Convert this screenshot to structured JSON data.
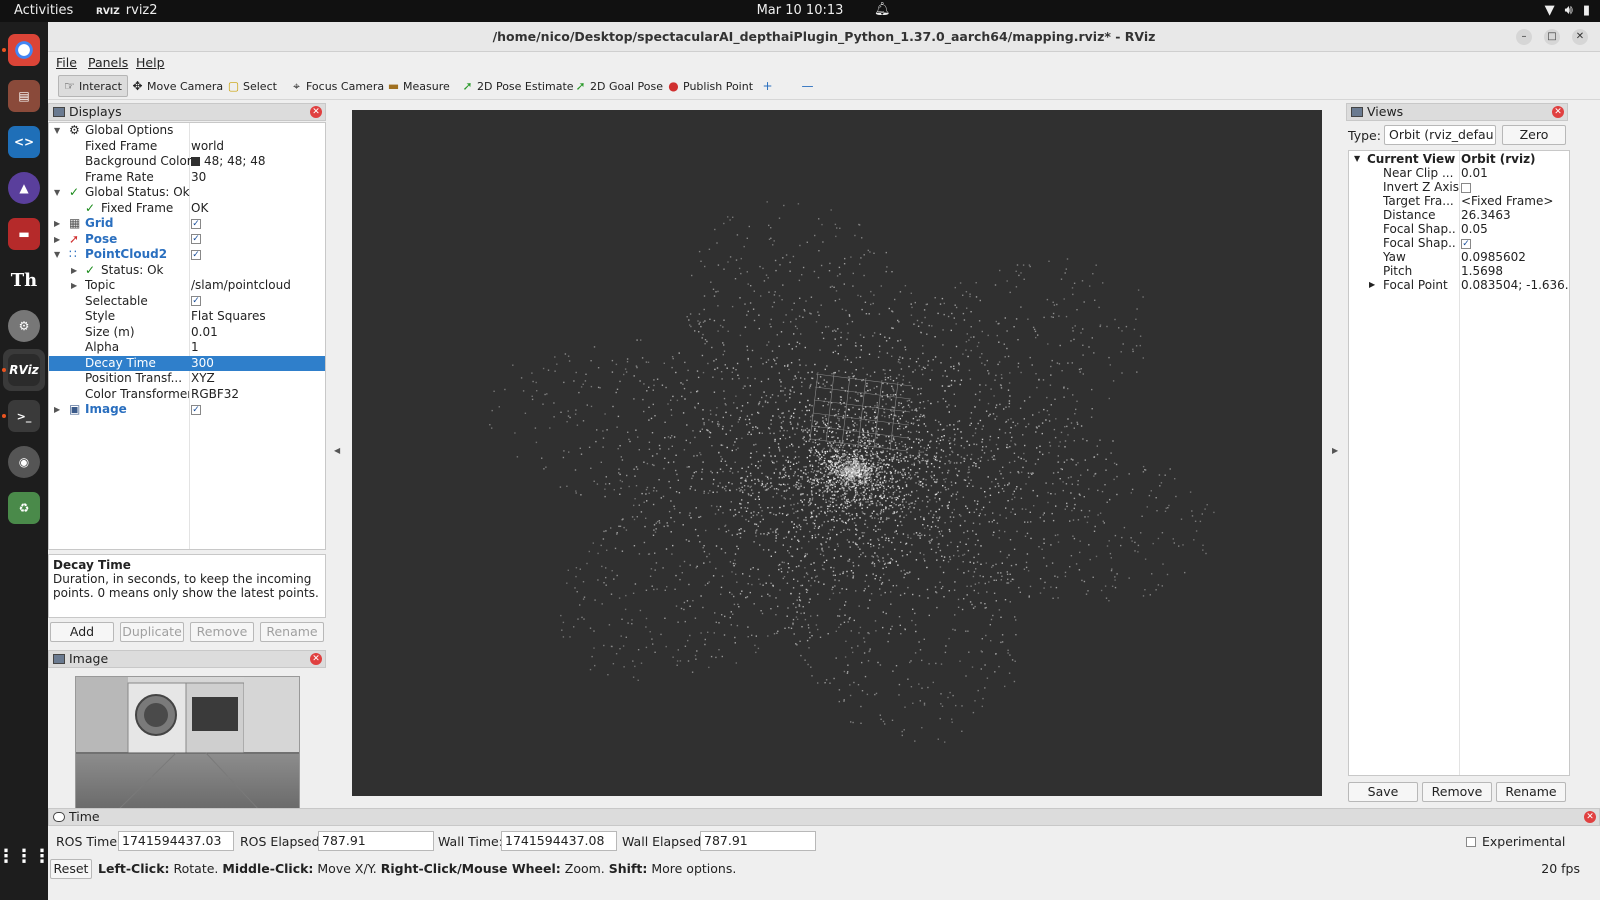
{
  "topbar": {
    "activities": "Activities",
    "app_name": "rviz2",
    "app_logo": "RVIZ",
    "clock": "Mar 10  10:13",
    "icons": [
      "notification-icon",
      "wifi-icon",
      "volume-icon",
      "battery-icon"
    ]
  },
  "dock": {
    "apps": [
      "chrome",
      "files",
      "vscode",
      "app-purple",
      "app-red",
      "typora",
      "settings",
      "rviz",
      "terminal",
      "disk",
      "trash",
      "show-apps"
    ],
    "rviz_label": "RViz"
  },
  "window": {
    "title": "/home/nico/Desktop/spectacularAI_depthaiPlugin_Python_1.37.0_aarch64/mapping.rviz* - RViz"
  },
  "menu": {
    "file": "File",
    "panels": "Panels",
    "help": "Help"
  },
  "toolbar": {
    "interact": "Interact",
    "move_camera": "Move Camera",
    "select": "Select",
    "focus_camera": "Focus Camera",
    "measure": "Measure",
    "pose_estimate": "2D Pose Estimate",
    "goal_pose": "2D Goal Pose",
    "publish_point": "Publish Point"
  },
  "displays": {
    "title": "Displays",
    "rows": {
      "global_options": "Global Options",
      "fixed_frame_k": "Fixed Frame",
      "fixed_frame_v": "world",
      "bg_color_k": "Background Color",
      "bg_color_v": "48; 48; 48",
      "frame_rate_k": "Frame Rate",
      "frame_rate_v": "30",
      "global_status": "Global Status: Ok",
      "gs_fixed_frame_k": "Fixed Frame",
      "gs_fixed_frame_v": "OK",
      "grid": "Grid",
      "pose": "Pose",
      "pointcloud": "PointCloud2",
      "status_ok": "Status: Ok",
      "topic_k": "Topic",
      "topic_v": "/slam/pointcloud",
      "selectable_k": "Selectable",
      "style_k": "Style",
      "style_v": "Flat Squares",
      "size_k": "Size (m)",
      "size_v": "0.01",
      "alpha_k": "Alpha",
      "alpha_v": "1",
      "decay_k": "Decay Time",
      "decay_v": "300",
      "pos_tf_k": "Position Transf...",
      "pos_tf_v": "XYZ",
      "color_tf_k": "Color Transformer",
      "color_tf_v": "RGBF32",
      "image": "Image"
    },
    "description_title": "Decay Time",
    "description_text": "Duration, in seconds, to keep the incoming points. 0 means only show the latest points.",
    "buttons": {
      "add": "Add",
      "duplicate": "Duplicate",
      "remove": "Remove",
      "rename": "Rename"
    }
  },
  "image_panel": {
    "title": "Image"
  },
  "views": {
    "title": "Views",
    "type_label": "Type:",
    "type_value": "Orbit (rviz_defau",
    "zero": "Zero",
    "rows": {
      "current_view_k": "Current View",
      "current_view_v": "Orbit (rviz)",
      "near_clip_k": "Near Clip ...",
      "near_clip_v": "0.01",
      "invert_z_k": "Invert Z Axis",
      "target_frame_k": "Target Fra...",
      "target_frame_v": "<Fixed Frame>",
      "distance_k": "Distance",
      "distance_v": "26.3463",
      "focal_shape1_k": "Focal Shap...",
      "focal_shape1_v": "0.05",
      "focal_shape2_k": "Focal Shap...",
      "yaw_k": "Yaw",
      "yaw_v": "0.0985602",
      "pitch_k": "Pitch",
      "pitch_v": "1.5698",
      "focal_point_k": "Focal Point",
      "focal_point_v": "0.083504; -1.636..."
    },
    "buttons": {
      "save": "Save",
      "remove": "Remove",
      "rename": "Rename"
    }
  },
  "time": {
    "title": "Time",
    "ros_time_label": "ROS Time:",
    "ros_time": "1741594437.03",
    "ros_elapsed_label": "ROS Elapsed:",
    "ros_elapsed": "787.91",
    "wall_time_label": "Wall Time:",
    "wall_time": "1741594437.08",
    "wall_elapsed_label": "Wall Elapsed:",
    "wall_elapsed": "787.91",
    "experimental": "Experimental",
    "reset": "Reset",
    "hint_b1": "Left-Click:",
    "hint_t1": " Rotate. ",
    "hint_b2": "Middle-Click:",
    "hint_t2": " Move X/Y. ",
    "hint_b3": "Right-Click/Mouse Wheel:",
    "hint_t3": " Zoom. ",
    "hint_b4": "Shift:",
    "hint_t4": " More options.",
    "fps": "20 fps"
  },
  "colors": {
    "viewport_bg": "#303030",
    "selection": "#2f7fcb",
    "accent_orange": "#e95420"
  }
}
